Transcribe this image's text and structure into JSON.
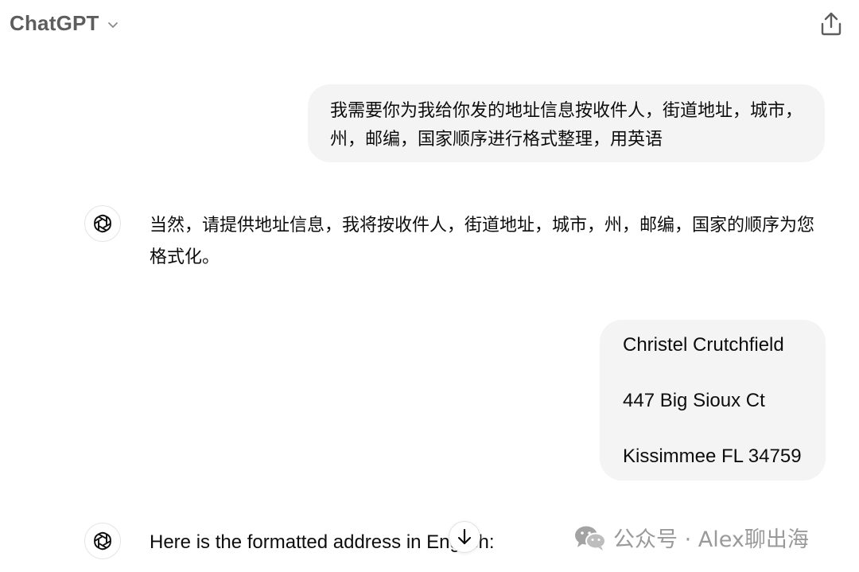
{
  "header": {
    "title": "ChatGPT",
    "title_icon": "chevron-down-icon",
    "share_icon": "share-icon"
  },
  "messages": [
    {
      "role": "user",
      "text": "我需要你为我给你发的地址信息按收件人，街道地址，城市，州，邮编，国家顺序进行格式整理，用英语"
    },
    {
      "role": "assistant",
      "icon": "openai-logo-icon",
      "text": "当然，请提供地址信息，我将按收件人，街道地址，城市，州，邮编，国家的顺序为您格式化。"
    },
    {
      "role": "user",
      "lines": [
        "Christel Crutchfield",
        "447 Big Sioux Ct",
        "Kissimmee FL 34759"
      ]
    },
    {
      "role": "assistant",
      "icon": "openai-logo-icon",
      "text": "Here is the formatted address in English:"
    }
  ],
  "scroll_button": {
    "icon": "arrow-down-icon"
  },
  "watermark": {
    "text": "公众号 · Alex聊出海",
    "icon": "wechat-icon"
  },
  "colors": {
    "user_bubble": "#f4f4f4",
    "header_text": "#5d5d5d",
    "body_text": "#0d0d0d",
    "watermark": "#9a9a9a"
  }
}
